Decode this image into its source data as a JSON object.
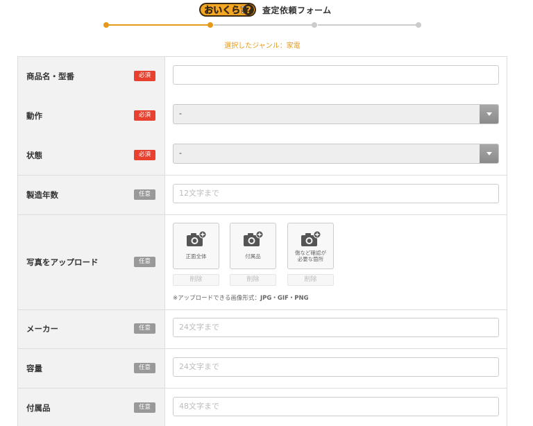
{
  "header": {
    "logo_text": "おいくら?",
    "form_title": "査定依頼フォーム"
  },
  "steps": {
    "total": 4,
    "current": 2,
    "active_color": "#e59a19",
    "inactive_color": "#cccccc"
  },
  "genre_text": "選択したジャンル：家電",
  "badges": {
    "required": "必須",
    "optional": "任意"
  },
  "fields": {
    "product_name": {
      "label": "商品名・型番",
      "placeholder": ""
    },
    "operation": {
      "label": "動作",
      "value": "-"
    },
    "condition": {
      "label": "状態",
      "value": "-"
    },
    "year": {
      "label": "製造年数",
      "placeholder": "12文字まで"
    },
    "photo": {
      "label": "写真をアップロード",
      "slots": [
        {
          "label": "正面全体"
        },
        {
          "label": "付属品"
        },
        {
          "label": "傷など確認が\n必要な箇所"
        }
      ],
      "delete_label": "削除",
      "note_prefix": "※アップロードできる画像形式：",
      "note_formats": "JPG・GIF・PNG"
    },
    "maker": {
      "label": "メーカー",
      "placeholder": "24文字まで"
    },
    "capacity": {
      "label": "容量",
      "placeholder": "24文字まで"
    },
    "accessories": {
      "label": "付属品",
      "placeholder": "48文字まで"
    }
  },
  "colors": {
    "accent": "#e59a19",
    "required_badge": "#e8412f",
    "optional_badge": "#999999"
  }
}
